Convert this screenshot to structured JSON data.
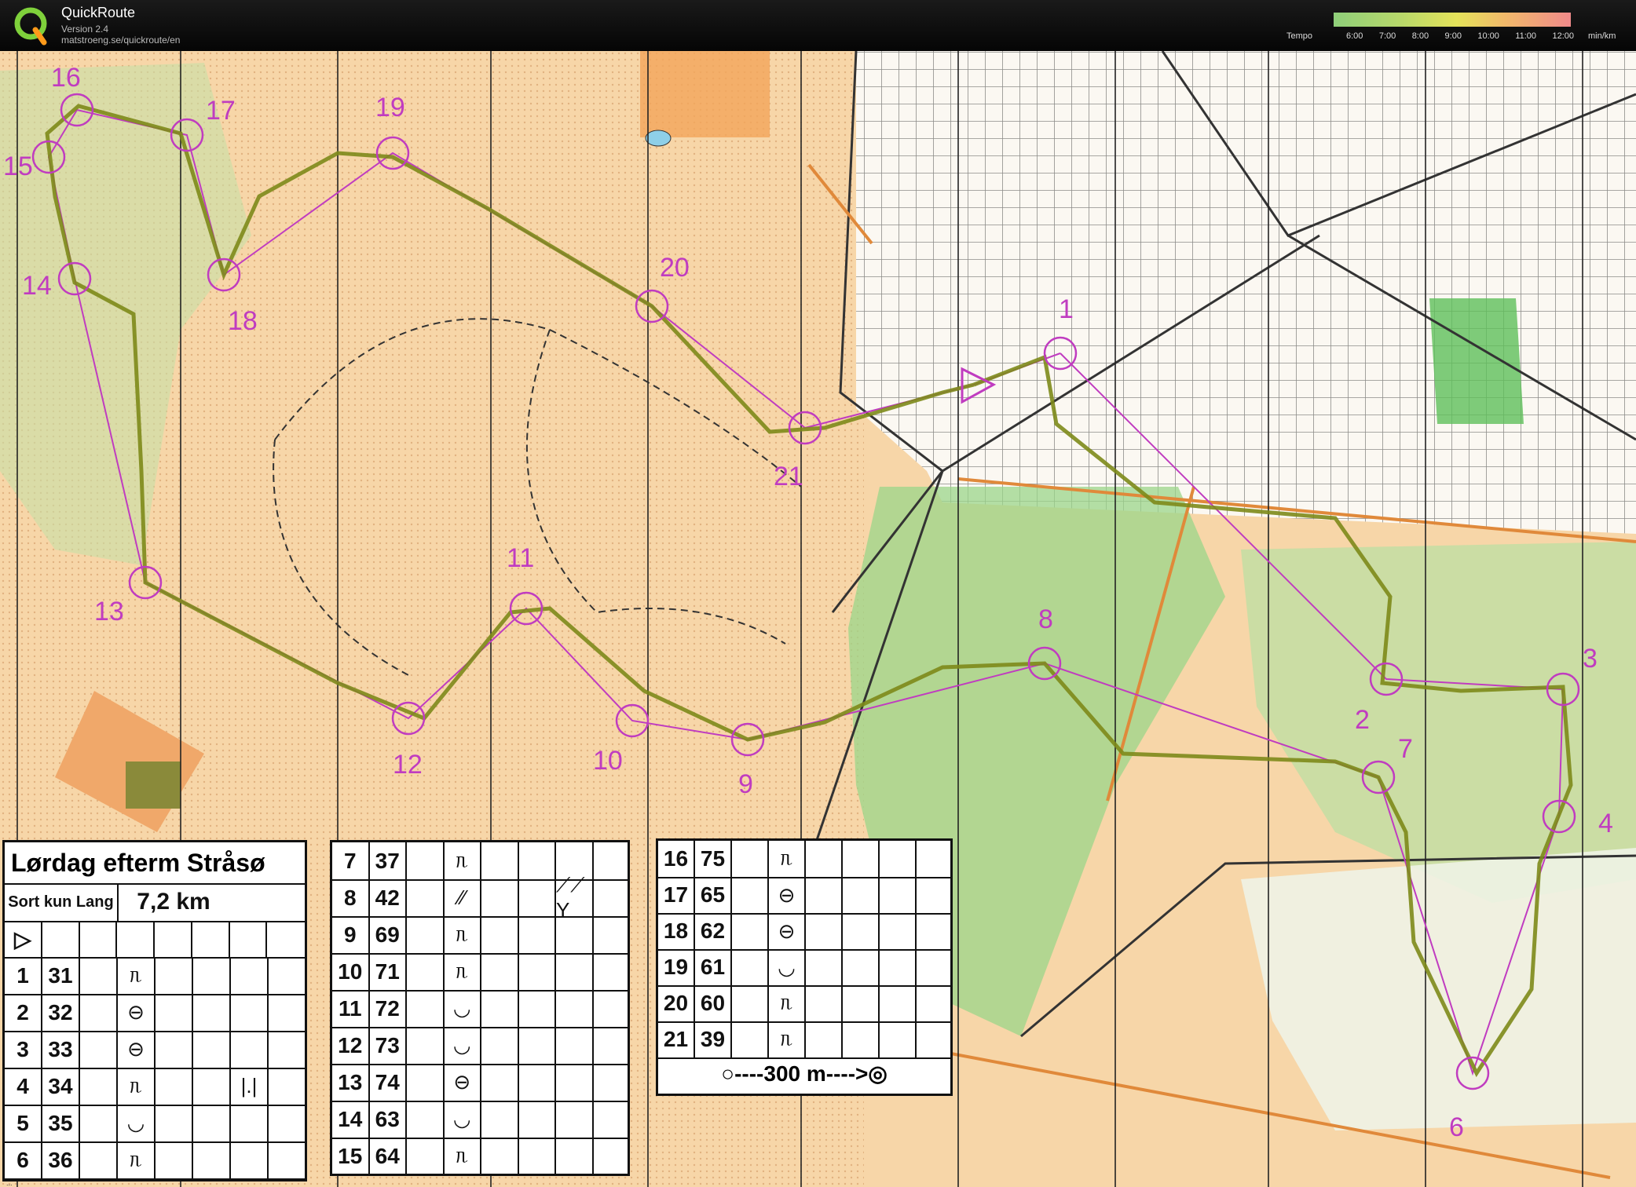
{
  "header": {
    "app_name": "QuickRoute",
    "version": "Version 2.4",
    "url": "matstroeng.se/quickroute/en",
    "tempo_label": "Tempo",
    "tempo_ticks": [
      "6:00",
      "7:00",
      "8:00",
      "9:00",
      "10:00",
      "11:00",
      "12:00"
    ],
    "tempo_unit": "min/km",
    "colors": {
      "slow": "#f08a8a",
      "medium": "#e4e25a",
      "fast": "#8fcf7a"
    }
  },
  "map": {
    "control_labels": [
      "16",
      "17",
      "19",
      "15",
      "14",
      "18",
      "20",
      "1",
      "21",
      "11",
      "13",
      "8",
      "12",
      "10",
      "9",
      "2",
      "7",
      "3",
      "4",
      "6"
    ],
    "colors": {
      "open_land": "#f3c994",
      "forest": "#8ecf7a",
      "route": "#6b8a1a",
      "course": "#c03cc0"
    }
  },
  "course": {
    "title": "Lørdag efterm Stråsø",
    "class": "Sort kun Lang",
    "distance": "7,2 km",
    "start_symbol": "▷",
    "scale_text": "○----300 m---->◎",
    "credit": "...",
    "controls": [
      {
        "n": "1",
        "code": "31",
        "sym": "ᥰ",
        "extra": ""
      },
      {
        "n": "2",
        "code": "32",
        "sym": "⊖",
        "extra": ""
      },
      {
        "n": "3",
        "code": "33",
        "sym": "⊖",
        "extra": ""
      },
      {
        "n": "4",
        "code": "34",
        "sym": "ᥰ",
        "extra": "|.|"
      },
      {
        "n": "5",
        "code": "35",
        "sym": "◡",
        "extra": ""
      },
      {
        "n": "6",
        "code": "36",
        "sym": "ᥰ",
        "extra": ""
      },
      {
        "n": "7",
        "code": "37",
        "sym": "ᥰ",
        "extra": ""
      },
      {
        "n": "8",
        "code": "42",
        "sym": "⁄⁄",
        "extra": "⟋⟋ Y"
      },
      {
        "n": "9",
        "code": "69",
        "sym": "ᥰ",
        "extra": ""
      },
      {
        "n": "10",
        "code": "71",
        "sym": "ᥰ",
        "extra": ""
      },
      {
        "n": "11",
        "code": "72",
        "sym": "◡",
        "extra": ""
      },
      {
        "n": "12",
        "code": "73",
        "sym": "◡",
        "extra": ""
      },
      {
        "n": "13",
        "code": "74",
        "sym": "⊖",
        "extra": ""
      },
      {
        "n": "14",
        "code": "63",
        "sym": "◡",
        "extra": ""
      },
      {
        "n": "15",
        "code": "64",
        "sym": "ᥰ",
        "extra": ""
      },
      {
        "n": "16",
        "code": "75",
        "sym": "ᥰ",
        "extra": ""
      },
      {
        "n": "17",
        "code": "65",
        "sym": "⊖",
        "extra": ""
      },
      {
        "n": "18",
        "code": "62",
        "sym": "⊖",
        "extra": ""
      },
      {
        "n": "19",
        "code": "61",
        "sym": "◡",
        "extra": ""
      },
      {
        "n": "20",
        "code": "60",
        "sym": "ᥰ",
        "extra": ""
      },
      {
        "n": "21",
        "code": "39",
        "sym": "ᥰ",
        "extra": ""
      }
    ]
  }
}
